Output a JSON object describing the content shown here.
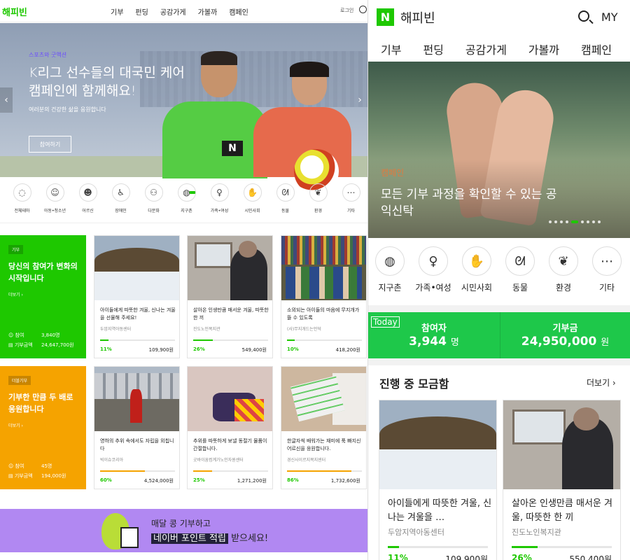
{
  "desktop": {
    "logo": "해피빈",
    "nav": [
      "기부",
      "펀딩",
      "공감가게",
      "가볼까",
      "캠페인"
    ],
    "login": "로그인",
    "hero": {
      "tag": "스포츠와 굿액션",
      "title": "K리그 선수들의 대국민 케어 캠페인에 함께해요!",
      "subtitle": "여러분의 건강한 삶을 응원합니다",
      "button": "참여하기",
      "prev": "‹",
      "next": "›"
    },
    "categories": [
      {
        "label": "전체테마",
        "icon": "◌"
      },
      {
        "label": "아동•청소년",
        "icon": "☺"
      },
      {
        "label": "어르신",
        "icon": "☻"
      },
      {
        "label": "장애인",
        "icon": "♿"
      },
      {
        "label": "다문화",
        "icon": "⚇"
      },
      {
        "label": "지구촌",
        "icon": "◍"
      },
      {
        "label": "가족•여성",
        "icon": "♀"
      },
      {
        "label": "시민사회",
        "icon": "✋"
      },
      {
        "label": "동물",
        "icon": "ᘛ"
      },
      {
        "label": "환경",
        "icon": "❦"
      },
      {
        "label": "기타",
        "icon": "⋯"
      }
    ],
    "promo1": {
      "tag": "기부",
      "title": "당신의 참여가 변화의 시작입니다",
      "more": "더보기 ›",
      "k1": "참여",
      "v1": "3,840명",
      "k2": "기부금액",
      "v2": "24,647,700원",
      "color": "#1ec800"
    },
    "promo2": {
      "tag": "더블기부",
      "title": "기부한 만큼 두 배로 응원합니다",
      "more": "더보기 ›",
      "k1": "참여",
      "v1": "45명",
      "k2": "기부금액",
      "v2": "194,000원",
      "color": "#f5a300"
    },
    "cards1": [
      {
        "title": "아이들에게 따뜻한 겨울, 신나는 겨울을 선물해 주세요!",
        "org": "두암지역아동센터",
        "pct": "11%",
        "amount": "109,900원",
        "progress": 0.11
      },
      {
        "title": "살아온 인생만큼 매서운 겨울, 따뜻한 한 끼",
        "org": "진도노인복지관",
        "pct": "26%",
        "amount": "549,400원",
        "progress": 0.26
      },
      {
        "title": "소외되는 아이들의 마음에 무지개가 뜰 수 있도록",
        "org": "(사)무지개드는언덕",
        "pct": "10%",
        "amount": "418,200원",
        "progress": 0.1
      }
    ],
    "cards2": [
      {
        "title": "영하의 추위 속에서도 자립을 외칩니다",
        "org": "빅이슈코리아",
        "pct": "60%",
        "amount": "4,524,000원",
        "progress": 0.6
      },
      {
        "title": "추위를 따뜻하게 보낼 동절기 물품이 간절합니다.",
        "org": "굿바이꿈컴계가노인자원센터",
        "pct": "25%",
        "amount": "1,271,200원",
        "progress": 0.25
      },
      {
        "title": "한글자씩 배워가는 재미에 푹 빠지신 어르신을 응원합니다.",
        "org": "경신사이르지복지센터",
        "pct": "86%",
        "amount": "1,732,600원",
        "progress": 0.86
      }
    ],
    "banner": {
      "line1": "매달 콩 기부하고",
      "highlight": "네이버 포인트 적립",
      "line2_rest": " 받으세요!"
    }
  },
  "mobile": {
    "logo_letter": "N",
    "title": "해피빈",
    "my": "MY",
    "nav": [
      "기부",
      "펀딩",
      "공감가게",
      "가볼까",
      "캠페인"
    ],
    "hero": {
      "tag": "캠페인",
      "title": "모든 기부 과정을 확인할 수 있는 공익신탁"
    },
    "categories": [
      {
        "label": "지구촌",
        "icon": "◍"
      },
      {
        "label": "가족•여성",
        "icon": "♀"
      },
      {
        "label": "시민사회",
        "icon": "✋"
      },
      {
        "label": "동물",
        "icon": "ᘛ"
      },
      {
        "label": "환경",
        "icon": "❦"
      },
      {
        "label": "기타",
        "icon": "⋯"
      }
    ],
    "today": {
      "label": "Today",
      "k1": "참여자",
      "v1": "3,944",
      "u1": "명",
      "k2": "기부금",
      "v2": "24,950,000",
      "u2": "원"
    },
    "section": {
      "title": "진행 중 모금함",
      "more": "더보기 ›"
    },
    "cards": [
      {
        "title": "아이들에게 따뜻한 겨울, 신나는 겨울을 …",
        "org": "두암지역아동센터",
        "pct": "11%",
        "amount": "109,900원",
        "progress": 0.11
      },
      {
        "title": "살아온 인생만큼 매서운 겨울, 따뜻한 한 끼",
        "org": "진도노인복지관",
        "pct": "26%",
        "amount": "550,400원",
        "progress": 0.26
      }
    ]
  },
  "colors": {
    "brand": "#1ec800",
    "orange": "#f5a300",
    "purple": "#b188f2"
  }
}
